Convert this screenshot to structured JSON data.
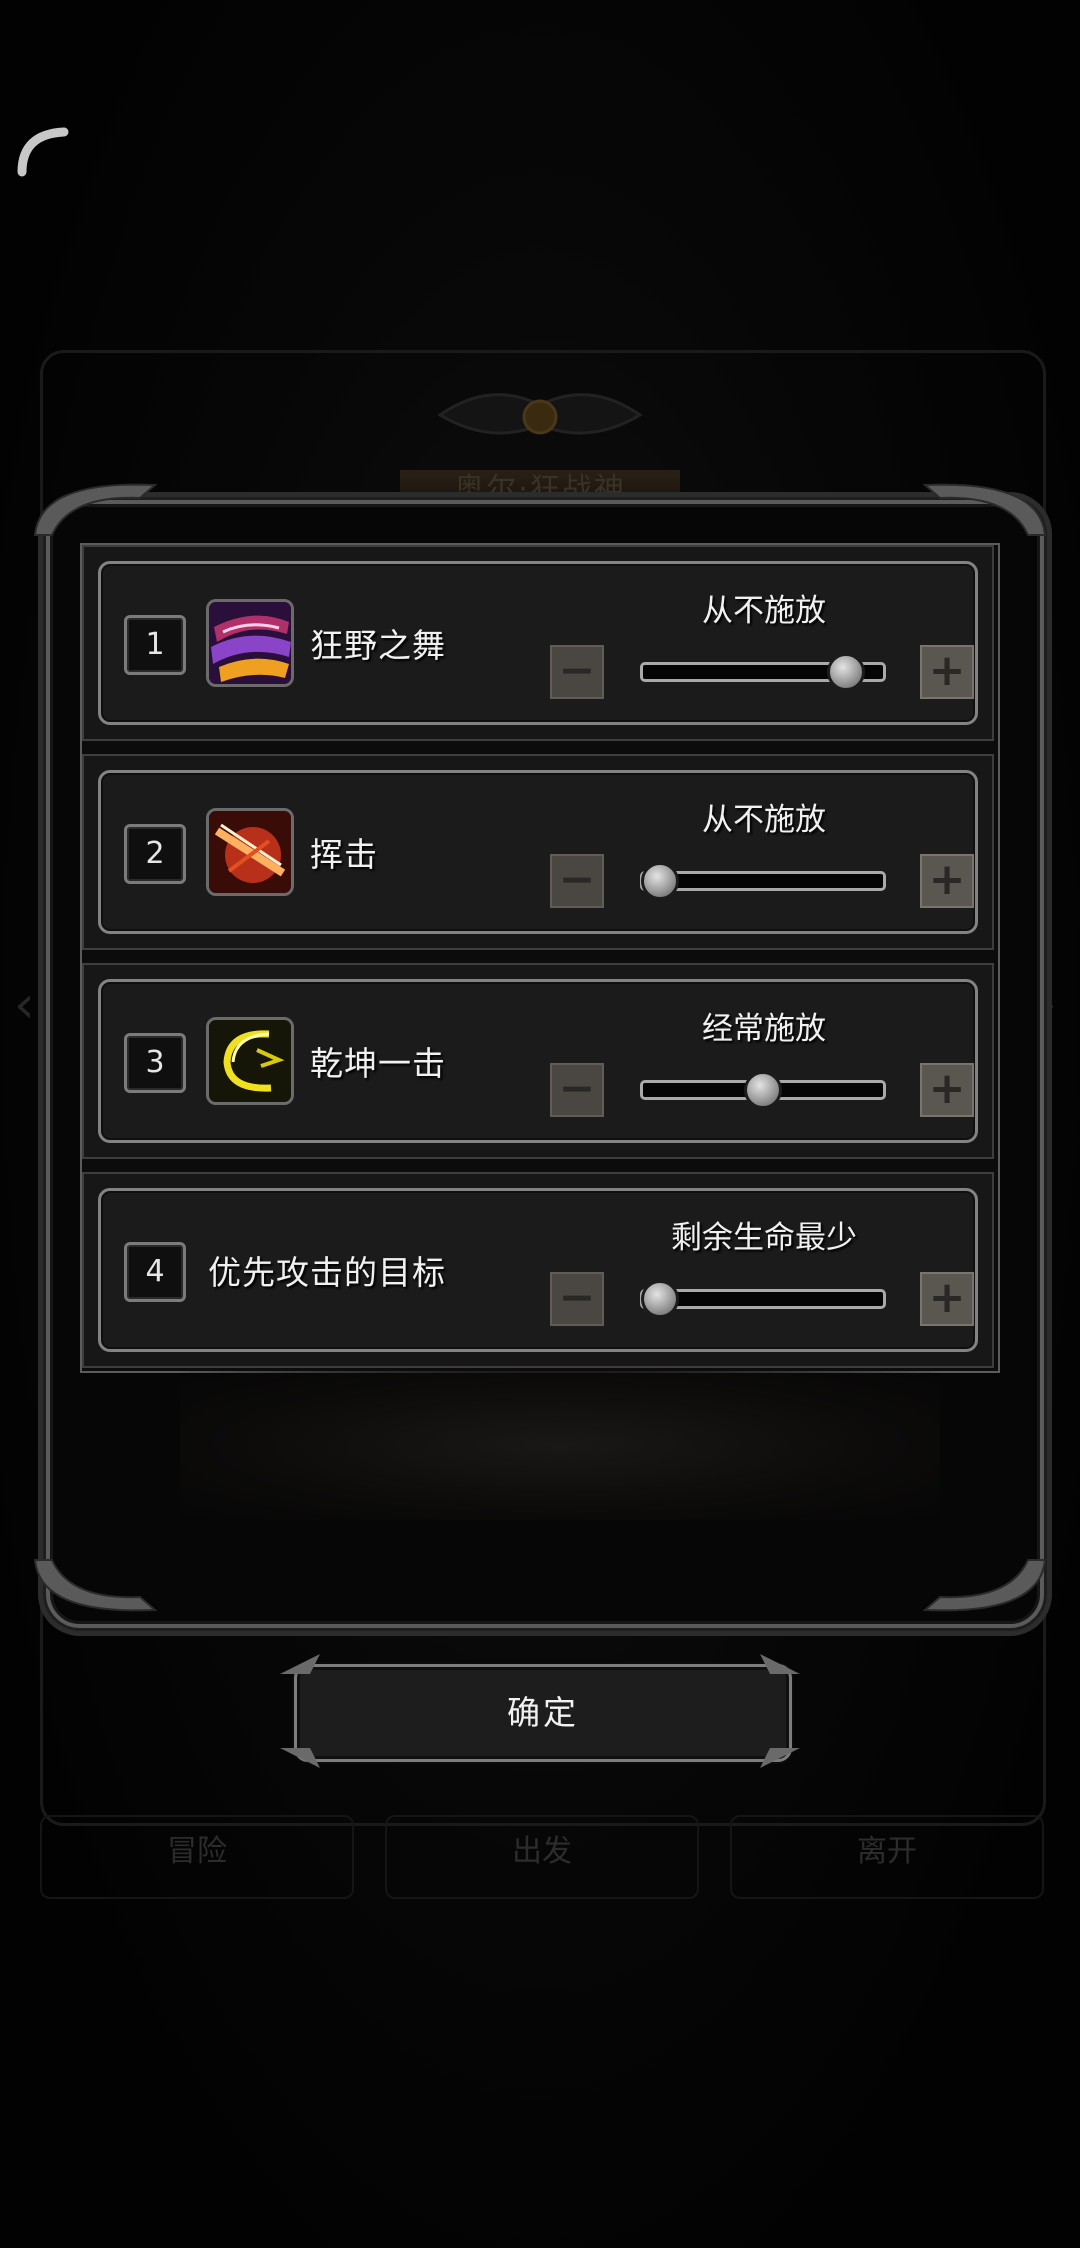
{
  "background": {
    "title": "奥尔·狂战神",
    "tabs": [
      "冒险",
      "出发",
      "离开"
    ]
  },
  "rows": [
    {
      "index": "1",
      "name": "狂野之舞",
      "icon": "purple-slash-skill-icon",
      "frequency": "从不施放",
      "level": 0.9
    },
    {
      "index": "2",
      "name": "挥击",
      "icon": "red-strike-skill-icon",
      "frequency": "从不施放",
      "level": 0.0
    },
    {
      "index": "3",
      "name": "乾坤一击",
      "icon": "yellow-arc-skill-icon",
      "frequency": "经常施放",
      "level": 0.5
    },
    {
      "index": "4",
      "name": "优先攻击的目标",
      "icon": "",
      "frequency": "剩余生命最少",
      "level": 0.0
    }
  ],
  "controls": {
    "minus": "−",
    "plus": "+"
  },
  "confirm_label": "确定"
}
